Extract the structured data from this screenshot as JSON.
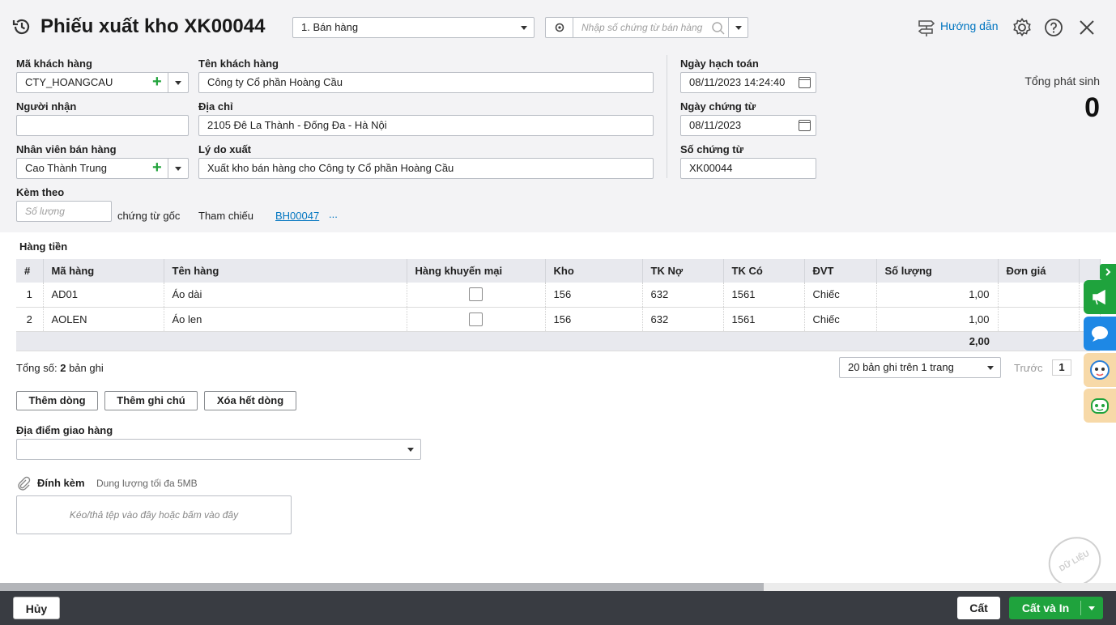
{
  "header": {
    "title": "Phiếu xuất kho XK00044",
    "type_select": "1. Bán hàng",
    "search_placeholder": "Nhập số chứng từ bán hàng",
    "help_label": "Hướng dẫn"
  },
  "form": {
    "customer_code_label": "Mã khách hàng",
    "customer_code": "CTY_HOANGCAU",
    "customer_name_label": "Tên khách hàng",
    "customer_name": "Công ty Cổ phần Hoàng Cầu",
    "receiver_label": "Người nhận",
    "receiver": "",
    "address_label": "Địa chỉ",
    "address": "2105 Đê La Thành - Đống Đa - Hà Nội",
    "salesperson_label": "Nhân viên bán hàng",
    "salesperson": "Cao Thành Trung",
    "reason_label": "Lý do xuất",
    "reason": "Xuất kho bán hàng cho Công ty Cổ phần Hoàng Cầu",
    "attach_label": "Kèm theo",
    "attach_placeholder": "Số lượng",
    "attach_suffix": "chứng từ gốc",
    "reference_label": "Tham chiếu",
    "reference_link": "BH00047",
    "reference_more": "...",
    "accounting_date_label": "Ngày hạch toán",
    "accounting_date": "08/11/2023 14:24:40",
    "voucher_date_label": "Ngày chứng từ",
    "voucher_date": "08/11/2023",
    "voucher_no_label": "Số chứng từ",
    "voucher_no": "XK00044",
    "total_label": "Tổng phát sinh",
    "total_value": "0"
  },
  "grid": {
    "section_title": "Hàng tiền",
    "columns": [
      "#",
      "Mã hàng",
      "Tên hàng",
      "Hàng khuyến mại",
      "Kho",
      "TK Nợ",
      "TK Có",
      "ĐVT",
      "Số lượng",
      "Đơn giá"
    ],
    "rows": [
      {
        "no": "1",
        "code": "AD01",
        "name": "Áo dài",
        "kho": "156",
        "tkno": "632",
        "tkco": "1561",
        "dvt": "Chiếc",
        "qty": "1,00"
      },
      {
        "no": "2",
        "code": "AOLEN",
        "name": "Áo len",
        "kho": "156",
        "tkno": "632",
        "tkco": "1561",
        "dvt": "Chiếc",
        "qty": "1,00"
      }
    ],
    "sum_qty": "2,00",
    "total_records_prefix": "Tổng số:",
    "total_records_count": "2",
    "total_records_suffix": "bản ghi",
    "page_size": "20 bản ghi trên 1 trang",
    "prev_label": "Trước",
    "page_number": "1"
  },
  "actions": {
    "add_row": "Thêm dòng",
    "add_note": "Thêm ghi chú",
    "delete_all": "Xóa hết dòng"
  },
  "delivery": {
    "label": "Địa điểm giao hàng",
    "value": ""
  },
  "attachment": {
    "label": "Đính kèm",
    "hint": "Dung lượng tối đa 5MB",
    "dropzone": "Kéo/thả tệp vào đây hoặc bấm vào đây"
  },
  "footer": {
    "cancel": "Hủy",
    "save": "Cất",
    "save_print": "Cất và In"
  },
  "watermark": "DỮ LIỆU MẪU",
  "colors": {
    "accent_green": "#1fa33d",
    "link_blue": "#0075c0",
    "footer_bg": "#393c42"
  }
}
